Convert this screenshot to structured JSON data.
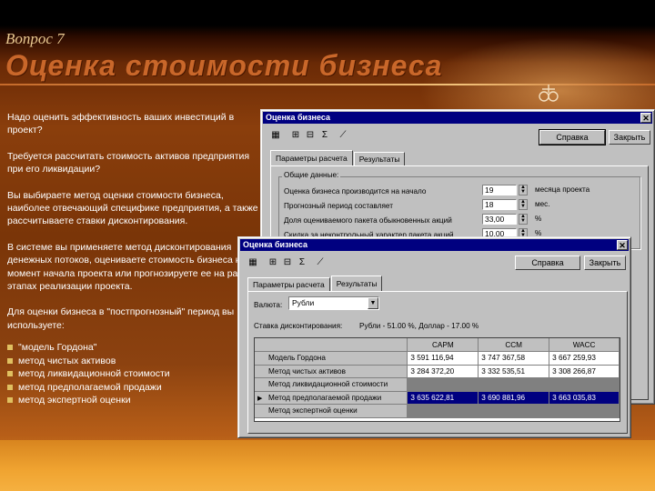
{
  "slide": {
    "question_label": "Вопрос 7",
    "title": "Оценка стоимости бизнеса",
    "paragraphs": [
      "Надо оценить эффективность ваших инвестиций в проект?",
      "Требуется рассчитать стоимость активов предприятия при его ликвидации?",
      "Вы выбираете метод оценки стоимости бизнеса, наиболее отвечающий специфике предприятия, а также рассчитываете ставки дисконтирования.",
      "В системе вы применяете метод дисконтирования денежных потоков, оцениваете стоимость бизнеса на момент начала проекта или прогнозируете ее на разных этапах реализации проекта.",
      "Для оценки бизнеса в \"постпрогнозный\" период вы используете:"
    ],
    "bullets": [
      "\"модель Гордона\"",
      "метод чистых активов",
      "метод ликвидационной стоимости",
      "метод предполагаемой продажи",
      "метод экспертной оценки"
    ]
  },
  "back_window": {
    "title": "Оценка бизнеса",
    "help_button": "Справка",
    "close_button": "Закрыть",
    "tabs": [
      "Параметры расчета",
      "Результаты"
    ],
    "group_label": "Общие данные:",
    "rows": [
      {
        "label": "Оценка бизнеса производится на начало",
        "value": "19",
        "unit": "месяца проекта"
      },
      {
        "label": "Прогнозный период составляет",
        "value": "18",
        "unit": "мес."
      },
      {
        "label": "Доля оцениваемого пакета обыкновенных акций",
        "value": "33,00",
        "unit": "%"
      },
      {
        "label": "Скидка за неконтрольный характер пакета акций",
        "value": "10,00",
        "unit": "%"
      }
    ]
  },
  "front_window": {
    "title": "Оценка бизнеса",
    "help_button": "Справка",
    "close_button": "Закрыть",
    "tabs": [
      "Параметры расчета",
      "Результаты"
    ],
    "currency_label": "Валюта:",
    "currency_value": "Рубли",
    "discount_label": "Ставка дисконтирования:",
    "discount_value": "Рубли - 51.00 %,   Доллар - 17.00 %",
    "table": {
      "columns": [
        "CAPM",
        "CCM",
        "WACC"
      ],
      "rows": [
        {
          "name": "Модель Гордона",
          "values": [
            "3 591 116,94",
            "3 747 367,58",
            "3 667 259,93"
          ],
          "state": "normal"
        },
        {
          "name": "Метод чистых активов",
          "values": [
            "3 284 372,20",
            "3 332 535,51",
            "3 308 266,87"
          ],
          "state": "normal"
        },
        {
          "name": "Метод ликвидационной стоимости",
          "values": [
            "",
            "",
            ""
          ],
          "state": "grey"
        },
        {
          "name": "Метод предполагаемой продажи",
          "values": [
            "3 635 622,81",
            "3 690 881,96",
            "3 663 035,83"
          ],
          "state": "selected"
        },
        {
          "name": "Метод экспертной оценки",
          "values": [
            "",
            "",
            ""
          ],
          "state": "grey"
        }
      ]
    }
  },
  "colors": {
    "title_color": "#c9672a",
    "titlebar": "#000080",
    "dialog": "#c0c0c0"
  }
}
